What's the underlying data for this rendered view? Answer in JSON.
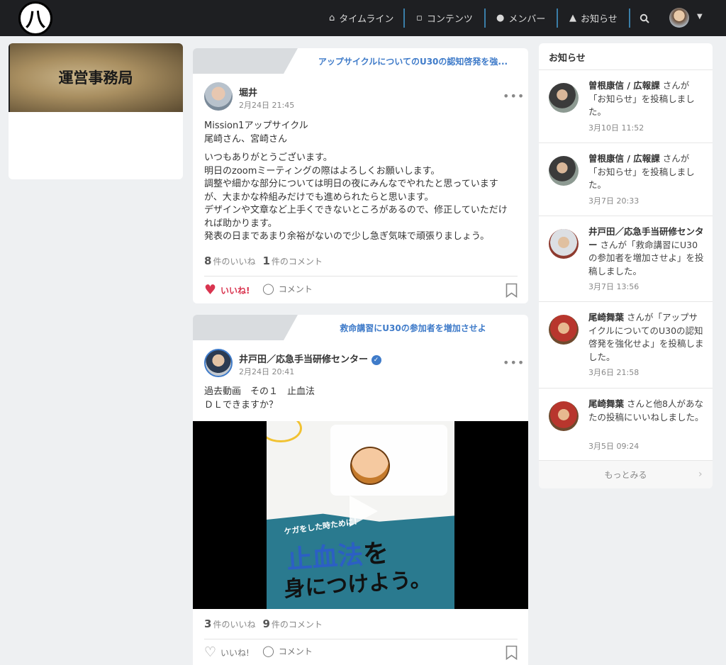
{
  "nav": {
    "timeline": "タイムライン",
    "contents": "コンテンツ",
    "members": "メンバー",
    "notices": "お知らせ",
    "logo": "八"
  },
  "left": {
    "banner": "運営事務局"
  },
  "post1": {
    "mission": "アップサイクルについてのU30の認知啓発を強...",
    "author": "堀井",
    "time": "2月24日 21:45",
    "paragraphs": [
      [
        "Mission1アップサイクル",
        "尾崎さん、宮崎さん"
      ],
      [
        "いつもありがとうございます。",
        "明日のzoomミーティングの際はよろしくお願いします。",
        "調整や細かな部分については明日の夜にみんなでやれたと思っています",
        "が、大まかな枠組みだけでも進められたらと思います。",
        "デザインや文章など上手くできないところがあるので、修正していただけ",
        "れば助かります。",
        "発表の日まであまり余裕がないので少し急ぎ気味で頑張りましょう。"
      ]
    ],
    "likes": "8",
    "likes_label": "件のいいね",
    "comments": "1",
    "comments_label": "件のコメント",
    "like_btn": "いいね!",
    "comment_btn": "コメント",
    "liked": true
  },
  "post2": {
    "mission": "救命講習にU30の参加者を増加させよ",
    "author": "井戸田／応急手当研修センター",
    "time": "2月24日 20:41",
    "lines": [
      "過去動画　その１　止血法",
      "ＤＬできますか？"
    ],
    "video": {
      "sub": "ケガをした時ために！",
      "title_a": "止血法",
      "title_b": "を",
      "title_c": "身につけよう。"
    },
    "likes": "3",
    "likes_label": "件のいいね",
    "comments": "9",
    "comments_label": "件のコメント",
    "like_btn": "いいね!",
    "comment_btn": "コメント",
    "liked": false
  },
  "notifications": {
    "title": "お知らせ",
    "more": "もっとみる",
    "items": [
      {
        "name": "曽根康信 / 広報課",
        "text": " さんが「お知らせ」を投稿しました。",
        "time": "3月10日 11:52"
      },
      {
        "name": "曽根康信 / 広報課",
        "text": " さんが「お知らせ」を投稿しました。",
        "time": "3月7日 20:33"
      },
      {
        "name": "井戸田／応急手当研修センター",
        "text": " さんが「救命講習にU30の参加者を増加させよ」を投稿しました。",
        "time": "3月7日 13:56"
      },
      {
        "name": "尾崎舞葉",
        "text": " さんが「アップサイクルについてのU30の認知啓発を強化せよ」を投稿しました。",
        "time": "3月6日 21:58"
      },
      {
        "name": "尾崎舞葉",
        "text": " さんと他8人があなたの投稿にいいねしました。",
        "time": "3月5日 09:24"
      }
    ]
  },
  "colors": {
    "accent": "#3f7bc9",
    "like": "#d9344f",
    "topbar": "#1e1f22"
  }
}
